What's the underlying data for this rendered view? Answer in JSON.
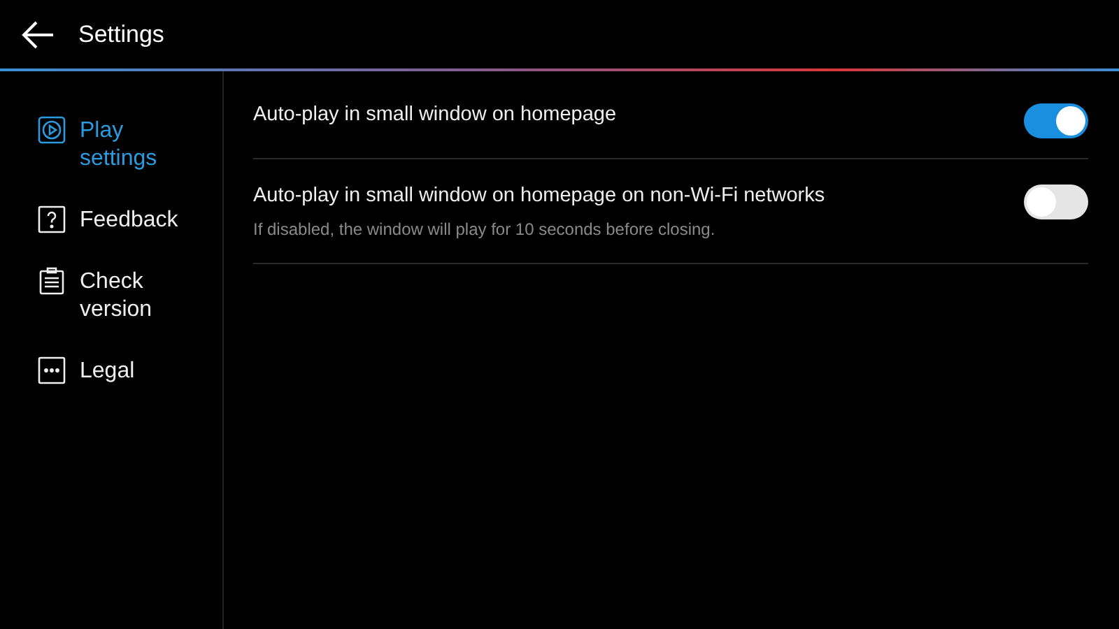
{
  "header": {
    "title": "Settings"
  },
  "sidebar": {
    "items": [
      {
        "label": "Play settings",
        "selected": true
      },
      {
        "label": "Feedback",
        "selected": false
      },
      {
        "label": "Check version",
        "selected": false
      },
      {
        "label": "Legal",
        "selected": false
      }
    ]
  },
  "settings": [
    {
      "label": "Auto-play in small window on homepage",
      "on": true
    },
    {
      "label": "Auto-play in small window on homepage on non-Wi-Fi networks",
      "description": "If disabled, the window will play for 10 seconds before closing.",
      "on": false
    }
  ]
}
